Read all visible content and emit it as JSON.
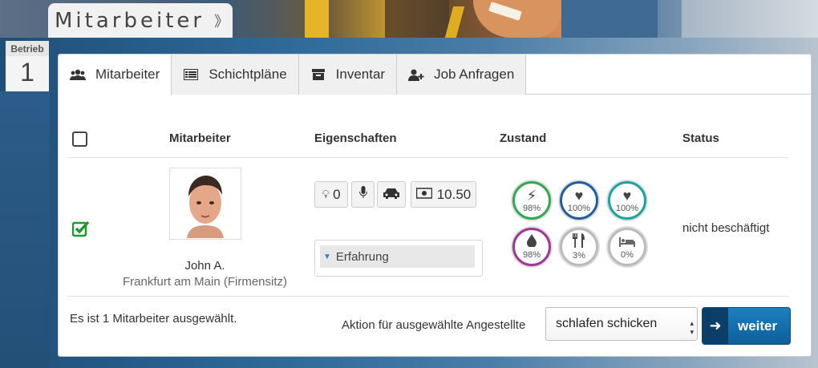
{
  "header": {
    "title": "Mitarbeiter",
    "toggle_icon": "double-chevron-down-icon"
  },
  "betrieb": {
    "label": "Betrieb",
    "number": "1"
  },
  "tabs": [
    {
      "label": "Mitarbeiter",
      "icon": "users-icon",
      "active": true
    },
    {
      "label": "Schichtpläne",
      "icon": "list-icon",
      "active": false
    },
    {
      "label": "Inventar",
      "icon": "archive-icon",
      "active": false
    },
    {
      "label": "Job Anfragen",
      "icon": "user-plus-icon",
      "active": false
    }
  ],
  "table": {
    "headers": {
      "employee": "Mitarbeiter",
      "properties": "Eigenschaften",
      "condition": "Zustand",
      "status": "Status"
    },
    "row": {
      "selected": true,
      "name": "John A.",
      "location": "Frankfurt am Main (Firmensitz)",
      "properties": {
        "idea_count": "0",
        "salary": "10.50"
      },
      "experience_label": "Erfahrung",
      "condition": [
        {
          "name": "energy",
          "icon": "lightning-icon",
          "value": "98%",
          "color": "#2fa84f"
        },
        {
          "name": "mood",
          "icon": "heart-icon",
          "value": "100%",
          "color": "#1f5f9e"
        },
        {
          "name": "health",
          "icon": "heartbeat-icon",
          "value": "100%",
          "color": "#19a3a3"
        },
        {
          "name": "hygiene",
          "icon": "drop-icon",
          "value": "98%",
          "color": "#a0359a"
        },
        {
          "name": "hunger",
          "icon": "cutlery-icon",
          "value": "3%",
          "color": "#999999"
        },
        {
          "name": "sleep",
          "icon": "bed-icon",
          "value": "0%",
          "color": "#999999"
        }
      ],
      "status": "nicht beschäftigt"
    }
  },
  "footer": {
    "selection_text": "Es ist 1 Mitarbeiter ausgewählt.",
    "action_label": "Aktion für ausgewählte Angestellte",
    "action_selected": "schlafen schicken",
    "submit_label": "weiter"
  }
}
